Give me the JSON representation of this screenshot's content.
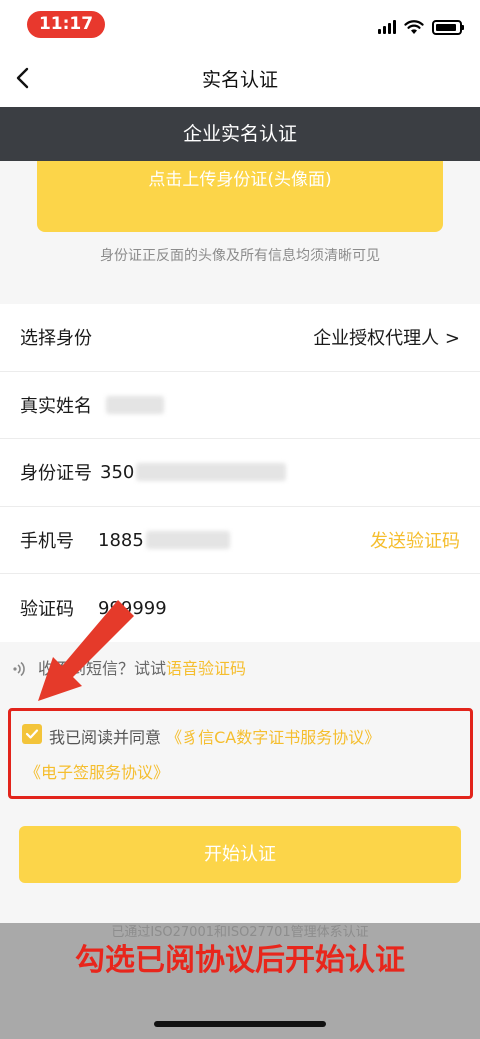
{
  "status_bar": {
    "time": "11:17"
  },
  "nav": {
    "title": "实名认证"
  },
  "sub_header": {
    "title": "企业实名认证"
  },
  "upload": {
    "button_label": "点击上传身份证(头像面)",
    "hint": "身份证正反面的头像及所有信息均须清晰可见"
  },
  "form": {
    "identity": {
      "label": "选择身份",
      "value": "企业授权代理人 >"
    },
    "name": {
      "label": "真实姓名"
    },
    "id_number": {
      "label": "身份证号",
      "value_prefix": "350"
    },
    "phone": {
      "label": "手机号",
      "value_prefix": "1885",
      "send_code": "发送验证码"
    },
    "code": {
      "label": "验证码",
      "value": "999999"
    }
  },
  "voice": {
    "prompt": "收不到短信？试试",
    "link": "语音验证码"
  },
  "agreement": {
    "text": "我已阅读并同意",
    "link1": "《豸信CA数字证书服务协议》",
    "link2": "《电子签服务协议》"
  },
  "start_button": {
    "label": "开始认证"
  },
  "footer": {
    "iso": "已通过ISO27001和ISO27701管理体系认证",
    "caption": "勾选已阅协议后开始认证"
  },
  "colors": {
    "accent": "#fcd549",
    "link": "#f5be2e",
    "annotation": "#e2241b"
  }
}
